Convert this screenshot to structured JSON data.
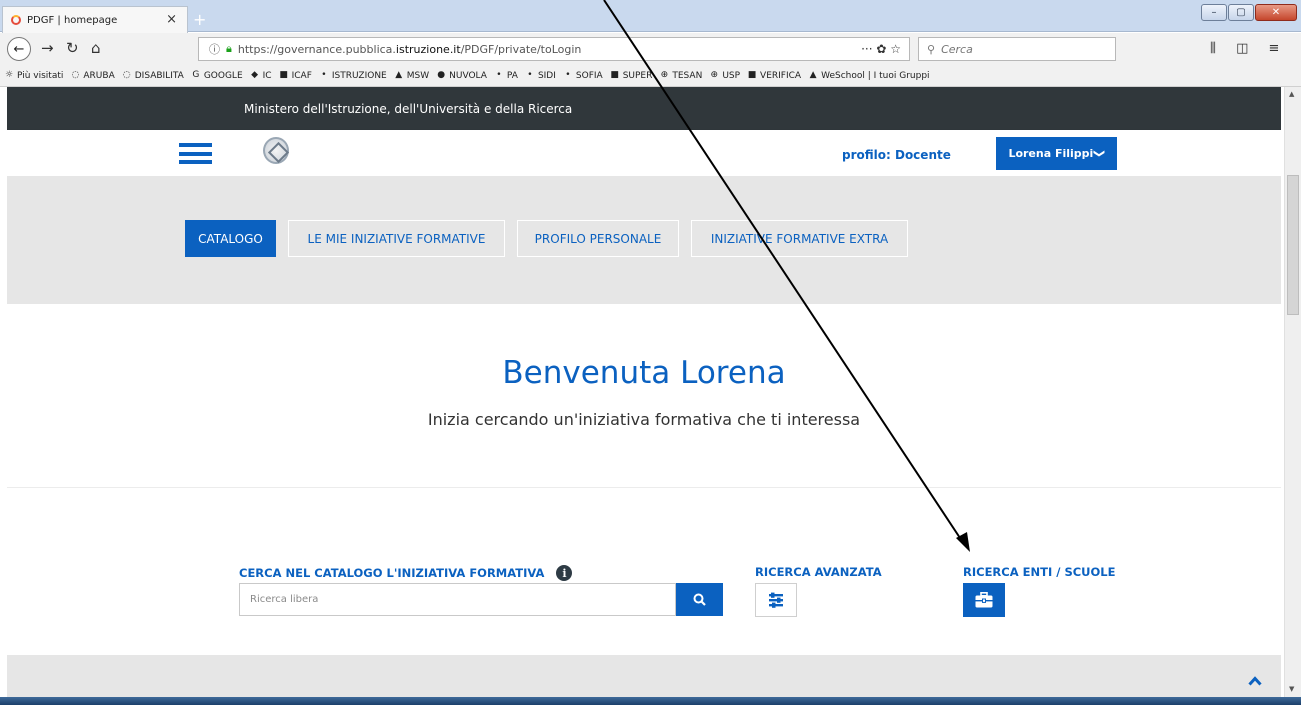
{
  "browser": {
    "tab_title": "PDGF | homepage",
    "tab_close": "×",
    "new_tab": "+",
    "url_prefix": "https://governance.pubblica.",
    "url_host": "istruzione.it",
    "url_path": "/PDGF/private/toLogin",
    "url_actions": "··· ✿ ☆",
    "search_placeholder": "Cerca",
    "window_min": "–",
    "window_max": "▢",
    "window_close": "✕",
    "right_icons": "⫼ ◫ ≡"
  },
  "bookmarks": [
    {
      "icon": "☼",
      "label": "Più visitati"
    },
    {
      "icon": "◌",
      "label": "ARUBA"
    },
    {
      "icon": "◌",
      "label": "DISABILITA"
    },
    {
      "icon": "G",
      "label": "GOOGLE"
    },
    {
      "icon": "◆",
      "label": "IC"
    },
    {
      "icon": "■",
      "label": "ICAF"
    },
    {
      "icon": "•",
      "label": "ISTRUZIONE"
    },
    {
      "icon": "▲",
      "label": "MSW"
    },
    {
      "icon": "●",
      "label": "NUVOLA"
    },
    {
      "icon": "•",
      "label": "PA"
    },
    {
      "icon": "•",
      "label": "SIDI"
    },
    {
      "icon": "•",
      "label": "SOFIA"
    },
    {
      "icon": "■",
      "label": "SUPER"
    },
    {
      "icon": "⊕",
      "label": "TESAN"
    },
    {
      "icon": "⊕",
      "label": "USP"
    },
    {
      "icon": "■",
      "label": "VERIFICA"
    },
    {
      "icon": "▲",
      "label": "WeSchool | I tuoi Gruppi"
    }
  ],
  "page": {
    "ministry": "Ministero dell'Istruzione, dell'Università e della Ricerca",
    "profile_label": "profilo: Docente",
    "user_name": "Lorena Filippi",
    "user_chevron": "❯",
    "tabs": [
      {
        "label": "CATALOGO",
        "active": true
      },
      {
        "label": "LE MIE INIZIATIVE FORMATIVE",
        "active": false
      },
      {
        "label": "PROFILO PERSONALE",
        "active": false
      },
      {
        "label": "INIZIATIVE FORMATIVE EXTRA",
        "active": false
      }
    ],
    "welcome": "Benvenuta Lorena",
    "subtitle": "Inizia cercando un'iniziativa formativa che ti interessa",
    "search_label": "CERCA NEL CATALOGO L'INIZIATIVA FORMATIVA",
    "info_glyph": "i",
    "search_placeholder": "Ricerca libera",
    "advanced_label": "RICERCA AVANZATA",
    "enti_label": "RICERCA ENTI / SCUOLE"
  },
  "colors": {
    "primary": "#0b61c0",
    "ministry_bar": "#30373b",
    "band": "#e6e6e6"
  }
}
